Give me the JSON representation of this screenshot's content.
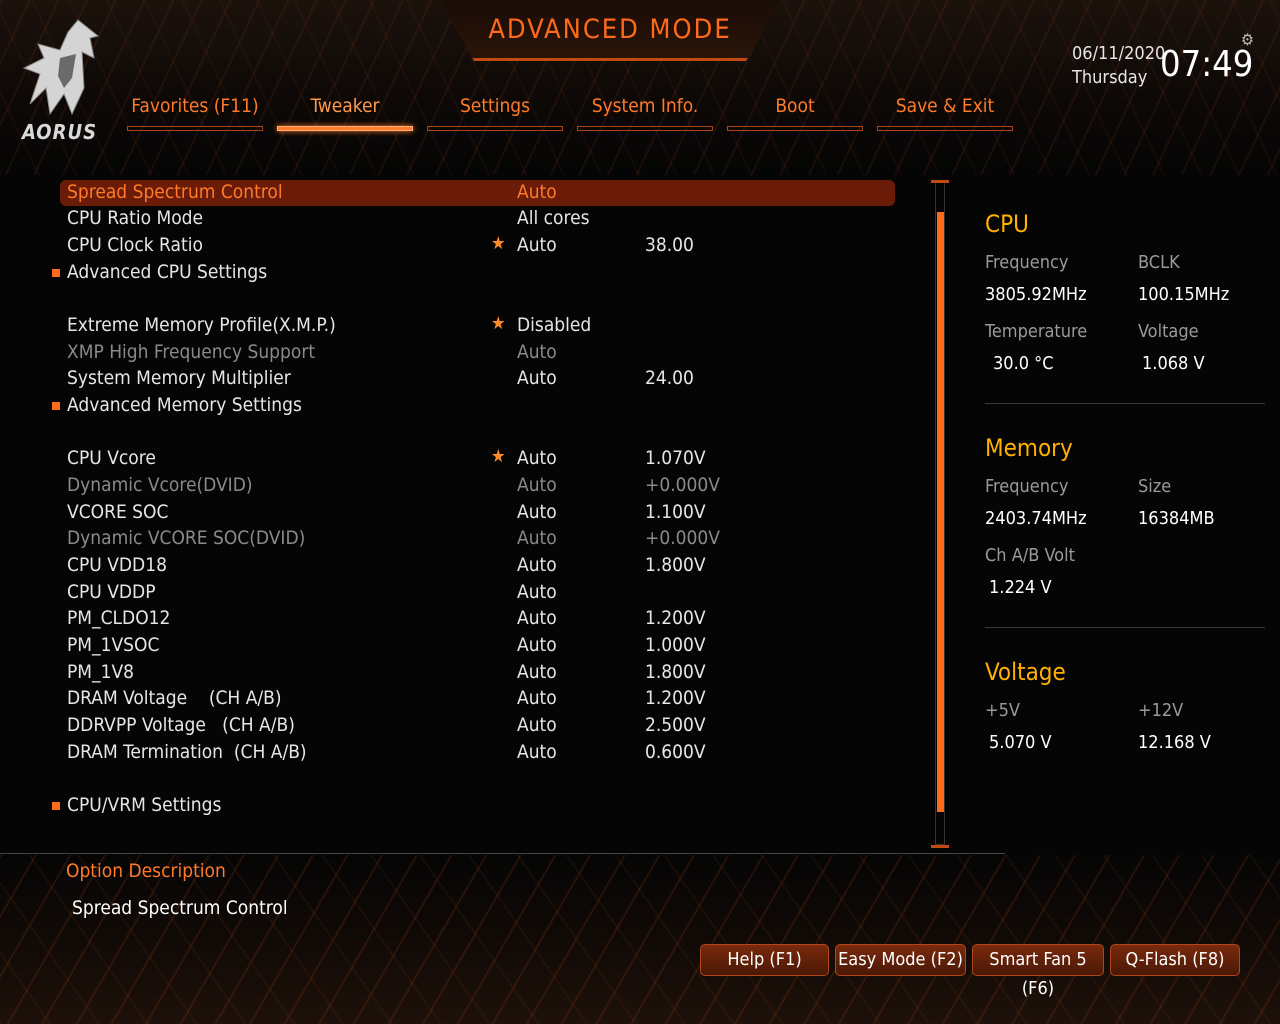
{
  "header": {
    "title": "ADVANCED MODE",
    "logo_text": "AORUS",
    "date": "06/11/2020",
    "day": "Thursday",
    "time": "07:49"
  },
  "tabs": [
    {
      "label": "Favorites (F11)",
      "active": false
    },
    {
      "label": "Tweaker",
      "active": true
    },
    {
      "label": "Settings",
      "active": false
    },
    {
      "label": "System Info.",
      "active": false
    },
    {
      "label": "Boot",
      "active": false
    },
    {
      "label": "Save & Exit",
      "active": false
    }
  ],
  "settings": [
    {
      "label": "Spread Spectrum Control",
      "value": "Auto",
      "value2": "",
      "highlighted": true
    },
    {
      "label": "CPU Ratio Mode",
      "value": "All cores",
      "value2": ""
    },
    {
      "label": "CPU Clock Ratio",
      "value": "Auto",
      "value2": "38.00",
      "star": true
    },
    {
      "label": "Advanced CPU Settings",
      "value": "",
      "value2": "",
      "submenu": true
    },
    {
      "label": "Extreme Memory Profile(X.M.P.)",
      "value": "Disabled",
      "value2": "",
      "star": true
    },
    {
      "label": "XMP High Frequency Support",
      "value": "Auto",
      "value2": "",
      "dim": true
    },
    {
      "label": "System Memory Multiplier",
      "value": "Auto",
      "value2": "24.00"
    },
    {
      "label": "Advanced Memory Settings",
      "value": "",
      "value2": "",
      "submenu": true
    },
    {
      "label": "CPU Vcore",
      "value": "Auto",
      "value2": "1.070V",
      "star": true
    },
    {
      "label": "Dynamic Vcore(DVID)",
      "value": "Auto",
      "value2": "+0.000V",
      "dim": true
    },
    {
      "label": "VCORE SOC",
      "value": "Auto",
      "value2": "1.100V"
    },
    {
      "label": "Dynamic VCORE SOC(DVID)",
      "value": "Auto",
      "value2": "+0.000V",
      "dim": true
    },
    {
      "label": "CPU VDD18",
      "value": "Auto",
      "value2": "1.800V"
    },
    {
      "label": "CPU VDDP",
      "value": "Auto",
      "value2": ""
    },
    {
      "label": "PM_CLDO12",
      "value": "Auto",
      "value2": "1.200V"
    },
    {
      "label": "PM_1VSOC",
      "value": "Auto",
      "value2": "1.000V"
    },
    {
      "label": "PM_1V8",
      "value": "Auto",
      "value2": "1.800V"
    },
    {
      "label": "DRAM Voltage    (CH A/B)",
      "value": "Auto",
      "value2": "1.200V"
    },
    {
      "label": "DDRVPP Voltage   (CH A/B)",
      "value": "Auto",
      "value2": "2.500V"
    },
    {
      "label": "DRAM Termination  (CH A/B)",
      "value": "Auto",
      "value2": "0.600V"
    },
    {
      "label": "CPU/VRM Settings",
      "value": "",
      "value2": "",
      "submenu": true
    }
  ],
  "info_panel": {
    "cpu": {
      "title": "CPU",
      "freq_label": "Frequency",
      "freq": "3805.92MHz",
      "bclk_label": "BCLK",
      "bclk": "100.15MHz",
      "temp_label": "Temperature",
      "temp": "30.0 °C",
      "volt_label": "Voltage",
      "volt": "1.068 V"
    },
    "memory": {
      "title": "Memory",
      "freq_label": "Frequency",
      "freq": "2403.74MHz",
      "size_label": "Size",
      "size": "16384MB",
      "chvolt_label": "Ch A/B Volt",
      "chvolt": "1.224 V"
    },
    "voltage": {
      "title": "Voltage",
      "v5_label": "+5V",
      "v5": "5.070 V",
      "v12_label": "+12V",
      "v12": "12.168 V"
    }
  },
  "description": {
    "title": "Option Description",
    "text": "Spread Spectrum Control"
  },
  "function_keys": [
    "Help (F1)",
    "Easy Mode (F2)",
    "Smart Fan 5 (F6)",
    "Q-Flash (F8)"
  ],
  "colors": {
    "accent": "#ff6a1a",
    "highlight_row": "#6a1c08",
    "panel_title": "#ffb000"
  }
}
